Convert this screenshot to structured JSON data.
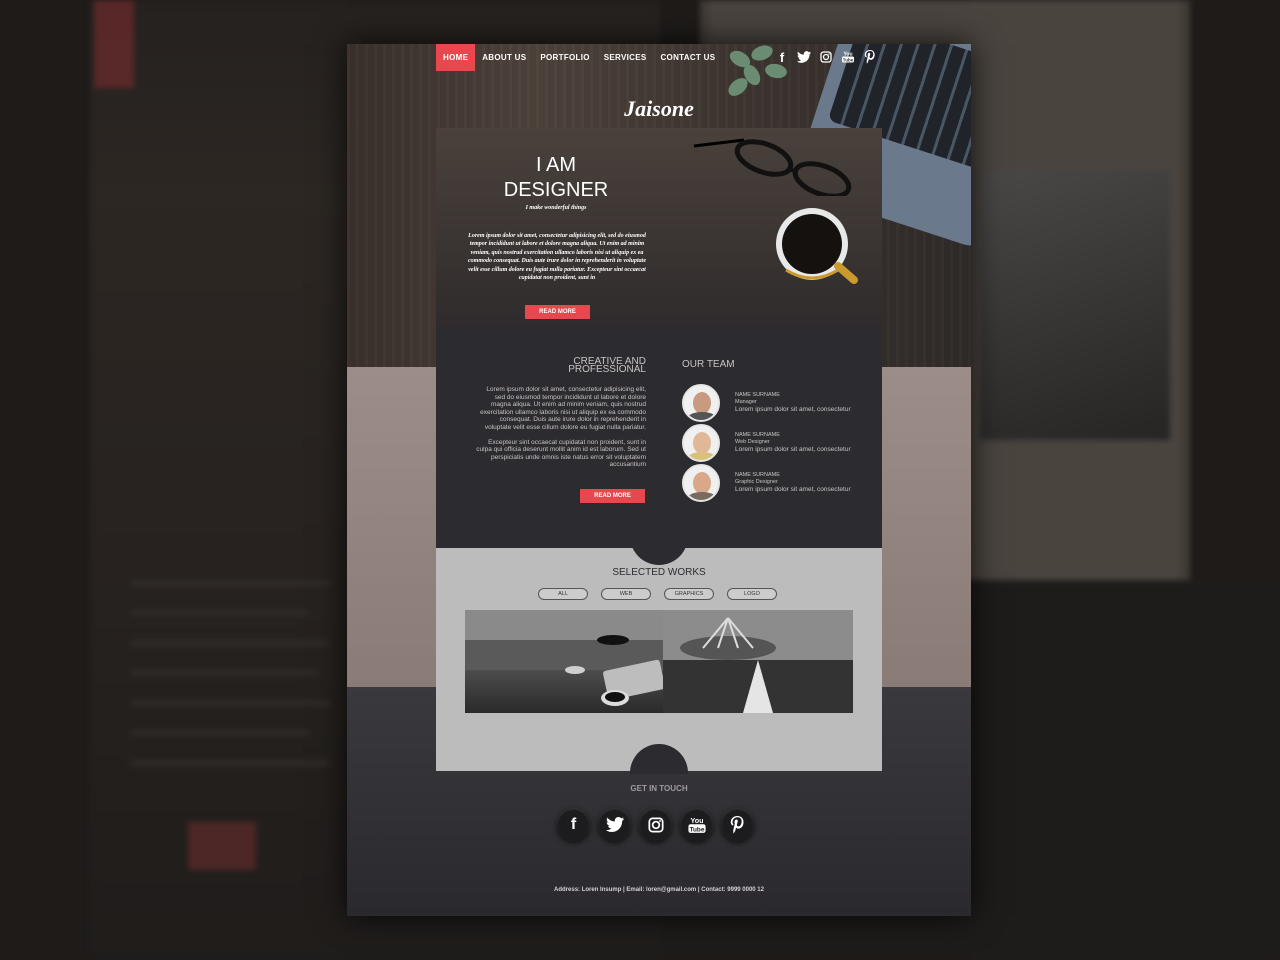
{
  "nav": {
    "items": [
      "HOME",
      "ABOUT US",
      "PORTFOLIO",
      "SERVICES",
      "CONTACT US"
    ],
    "active": "HOME"
  },
  "brand": "Jaisone",
  "hero": {
    "title_line1": "I AM",
    "title_line2": "DESIGNER",
    "subtitle": "I make wonderful things",
    "body": "Lorem ipsum dolor sit amet, consectetur adipisicing elit, sed do eiusmod tempor incididunt ut labore et dolore magna aliqua. Ut enim ad minim veniam, quis nostrud exercitation ullamco laboris nisi ut aliquip ex ea commodo consequat. Duis aute irure dolor in reprehenderit in voluptate velit esse cillum dolore eu fugiat nulla pariatur. Excepteur sint occaecat cupidatat non proident, sunt in",
    "button": "READ MORE"
  },
  "creative": {
    "title_line1": "CREATIVE AND",
    "title_line2": "PROFESSIONAL",
    "para1": "Lorem ipsum dolor sit amet, consectetur adipisicing elit, sed do eiusmod tempor incididunt ut labore et dolore magna aliqua. Ut enim ad minim veniam, quis nostrud exercitation ullamco laboris nisi ut aliquip ex ea commodo consequat. Duis aute irure dolor in reprehenderit in voluptate velit esse cillum dolore eu fugiat nulla pariatur.",
    "para2": "Excepteur sint occaecat cupidatat non proident, sunt in culpa qui officia deserunt mollit anim id est laborum. Sed ut perspiciatis unde omnis iste natus error sit voluptatem accusantium",
    "button": "READ MORE"
  },
  "team": {
    "title": "OUR TEAM",
    "members": [
      {
        "name": "NAME SURNAME",
        "role": "Manager",
        "desc": "Lorem ipsum dolor sit amet, consectetur"
      },
      {
        "name": "NAME SURNAME",
        "role": "Web Designer",
        "desc": "Lorem ipsum dolor sit amet, consectetur"
      },
      {
        "name": "NAME SURNAME",
        "role": "Graphic Designer",
        "desc": "Lorem ipsum dolor sit amet, consectetur"
      }
    ]
  },
  "works": {
    "title": "SELECTED WORKS",
    "filters": [
      "ALL",
      "WEB",
      "GRAPHICS",
      "LOGO"
    ]
  },
  "footer": {
    "get_in_touch": "GET IN TOUCH",
    "address": "Address: Loren Insump | Email: loren@gmail.com | Contact: 9999 0000 12"
  },
  "social": [
    "facebook-icon",
    "twitter-icon",
    "instagram-icon",
    "youtube-icon",
    "pinterest-icon"
  ],
  "colors": {
    "accent": "#e8484d",
    "dark": "#2c2b30",
    "works_bg": "#bcbcbc"
  }
}
